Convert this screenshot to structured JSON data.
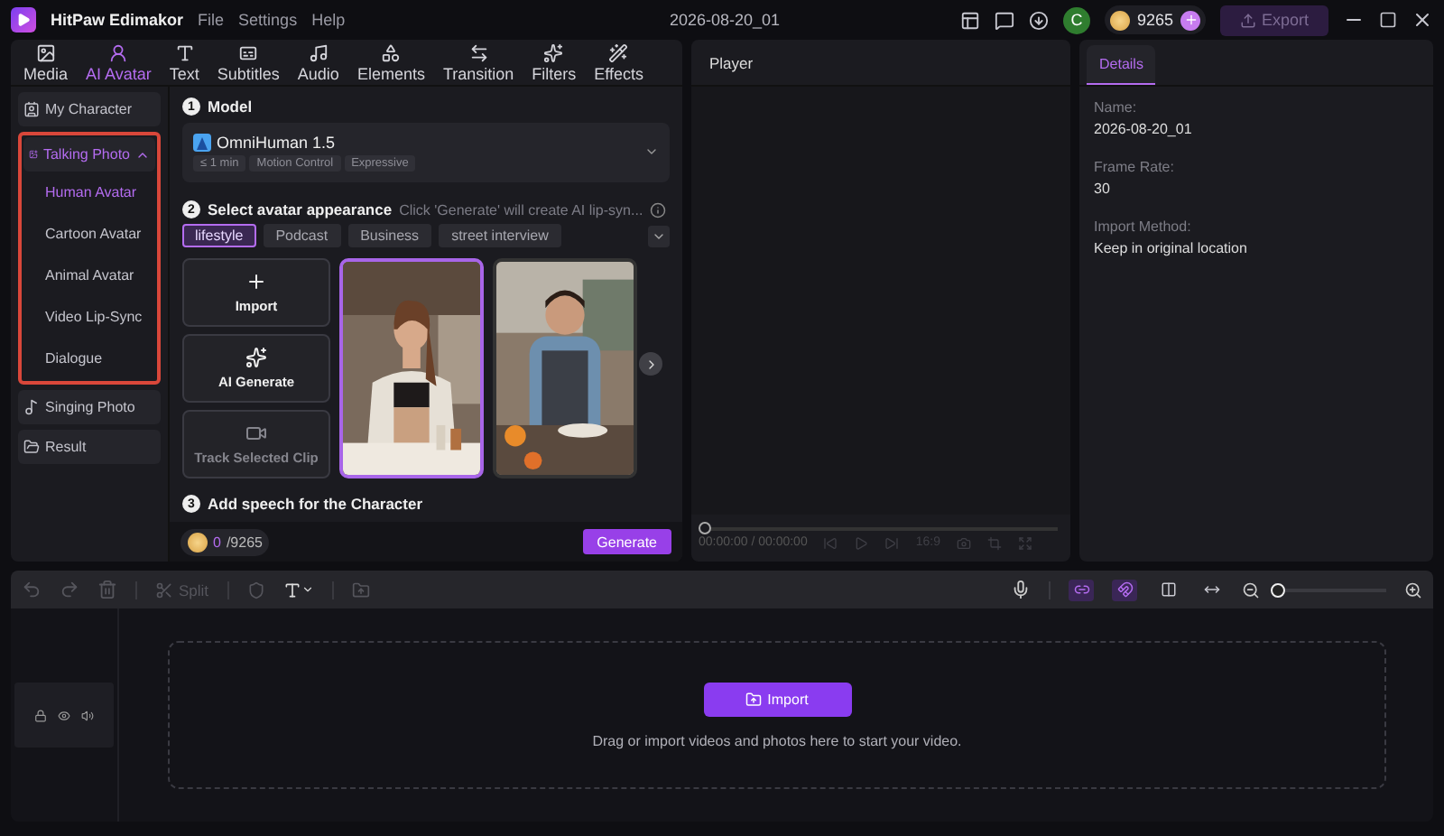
{
  "app": {
    "name": "HitPaw Edimakor",
    "menu": [
      "File",
      "Settings",
      "Help"
    ],
    "project_title": "2026-08-20_01",
    "account_letter": "C",
    "credits": "9265",
    "export": {
      "label": "Export",
      "disabled": true
    }
  },
  "toolbar_tabs": [
    {
      "kind": "media",
      "label": "Media",
      "selected": false
    },
    {
      "kind": "avatar",
      "label": "AI Avatar",
      "selected": true
    },
    {
      "kind": "text",
      "label": "Text",
      "selected": false
    },
    {
      "kind": "subtitles",
      "label": "Subtitles",
      "selected": false
    },
    {
      "kind": "audio",
      "label": "Audio",
      "selected": false
    },
    {
      "kind": "elements",
      "label": "Elements",
      "selected": false
    },
    {
      "kind": "transition",
      "label": "Transition",
      "selected": false
    },
    {
      "kind": "filters",
      "label": "Filters",
      "selected": false
    },
    {
      "kind": "effects",
      "label": "Effects",
      "selected": false
    }
  ],
  "sidebar": {
    "items": [
      {
        "kind": "character",
        "label": "My Character",
        "selected": false
      },
      {
        "kind": "talking",
        "label": "Talking Photo",
        "selected": true,
        "expanded": true,
        "highlighted": true,
        "children": [
          {
            "label": "Human Avatar",
            "selected": true
          },
          {
            "label": "Cartoon Avatar",
            "selected": false
          },
          {
            "label": "Animal Avatar",
            "selected": false
          },
          {
            "label": "Video Lip-Sync",
            "selected": false
          },
          {
            "label": "Dialogue",
            "selected": false
          }
        ]
      },
      {
        "kind": "singing",
        "label": "Singing Photo",
        "selected": false
      },
      {
        "kind": "result",
        "label": "Result",
        "selected": false
      }
    ]
  },
  "model": {
    "step": "1",
    "heading": "Model",
    "name": "OmniHuman 1.5",
    "tags": [
      "≤ 1 min",
      "Motion Control",
      "Expressive"
    ]
  },
  "appearance": {
    "step": "2",
    "heading": "Select avatar appearance",
    "hint": "Click 'Generate' will create AI lip-syn...",
    "categories": [
      {
        "label": "lifestyle",
        "selected": true
      },
      {
        "label": "Podcast",
        "selected": false
      },
      {
        "label": "Business",
        "selected": false
      },
      {
        "label": "street interview",
        "selected": false
      }
    ],
    "actions": [
      {
        "kind": "import",
        "label": "Import",
        "disabled": false
      },
      {
        "kind": "ai",
        "label": "AI Generate",
        "disabled": false
      },
      {
        "kind": "track",
        "label": "Track Selected Clip",
        "disabled": true
      }
    ],
    "avatars": [
      {
        "kind": "picture",
        "selected": true
      },
      {
        "kind": "picture",
        "selected": false
      }
    ]
  },
  "speech": {
    "step": "3",
    "heading": "Add speech for the Character",
    "credits_used": "0",
    "credits_total": "/9265",
    "generate": "Generate"
  },
  "player": {
    "title": "Player",
    "progress": {
      "level": 0
    },
    "timecode": "00:00:00",
    "duration": "/ 00:00:00",
    "ratio": "16:9"
  },
  "details": {
    "tab": {
      "label": "Details",
      "selected": true
    },
    "fields": [
      {
        "label": "Name:",
        "value": "2026-08-20_01"
      },
      {
        "label": "Frame Rate:",
        "value": "30"
      },
      {
        "label": "Import Method:",
        "value": "Keep in original location"
      }
    ]
  },
  "timeline": {
    "split": "Split",
    "tools": [
      {
        "kind": "link",
        "on": true
      },
      {
        "kind": "magnet",
        "on": true
      },
      {
        "kind": "split",
        "on": false
      },
      {
        "kind": "fit",
        "on": false
      }
    ],
    "zoom": {
      "level": 0
    },
    "import": "Import",
    "hint": "Drag or import videos and photos here to start your video."
  }
}
